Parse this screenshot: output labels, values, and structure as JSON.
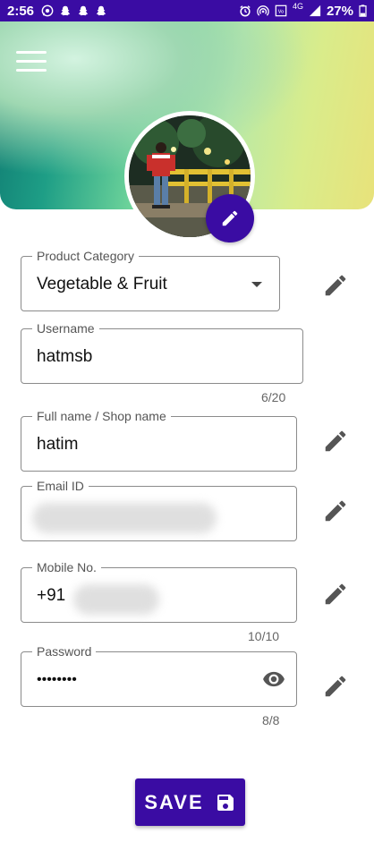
{
  "status_bar": {
    "time": "2:56",
    "battery": "27%",
    "network": "4G",
    "left_icons": [
      "whatsapp-icon",
      "snapchat-icon",
      "snapchat-icon",
      "snapchat-icon"
    ],
    "right_icons": [
      "alarm-icon",
      "hotspot-icon",
      "volte-icon",
      "signal-icon",
      "battery-icon"
    ]
  },
  "header": {
    "colors": {
      "accent": "#3a0ca3",
      "gradient_start": "#0f7a71",
      "gradient_end": "#e8e27a"
    }
  },
  "form": {
    "product_category": {
      "label": "Product Category",
      "value": "Vegetable & Fruit"
    },
    "username": {
      "label": "Username",
      "value": "hatmsb",
      "counter": "6/20"
    },
    "full_name": {
      "label": "Full name / Shop name",
      "value": "hatim"
    },
    "email": {
      "label": "Email ID",
      "value": ""
    },
    "mobile": {
      "label": "Mobile No.",
      "value": "+91",
      "counter": "10/10"
    },
    "password": {
      "label": "Password",
      "value": "••••••••",
      "counter": "8/8"
    }
  },
  "save_button": {
    "label": "SAVE"
  }
}
